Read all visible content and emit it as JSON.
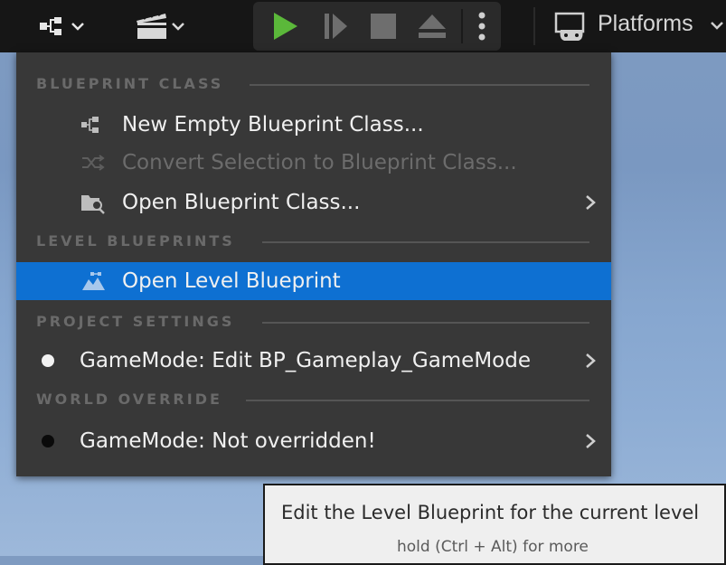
{
  "toolbar": {
    "blueprint_button_icon": "blueprint-graph-icon",
    "cinematics_button_icon": "clapperboard-icon",
    "play_controls": [
      "play-icon",
      "advance-frame-icon",
      "stop-icon",
      "eject-icon",
      "more-vertical-icon"
    ],
    "platforms_label": "Platforms",
    "play_color": "#5bb83a"
  },
  "menu": {
    "sections": [
      {
        "title": "BLUEPRINT CLASS"
      },
      {
        "title": "LEVEL BLUEPRINTS"
      },
      {
        "title": "PROJECT SETTINGS"
      },
      {
        "title": "WORLD OVERRIDE"
      }
    ],
    "items": [
      {
        "label": "New Empty Blueprint Class...",
        "icon": "blueprint-class-icon",
        "enabled": true
      },
      {
        "label": "Convert Selection to Blueprint Class...",
        "icon": "convert-shuffle-icon",
        "enabled": false
      },
      {
        "label": "Open Blueprint Class...",
        "icon": "folder-search-icon",
        "enabled": true,
        "submenu": true
      },
      {
        "label": "Open Level Blueprint",
        "icon": "level-blueprint-icon",
        "enabled": true,
        "highlighted": true
      },
      {
        "label": "GameMode: Edit BP_Gameplay_GameMode",
        "icon": "white-dot-icon",
        "enabled": true,
        "submenu": true
      },
      {
        "label": "GameMode: Not overridden!",
        "icon": "black-dot-icon",
        "enabled": true,
        "submenu": true
      }
    ],
    "highlight_color": "#0e70d2"
  },
  "tooltip": {
    "main": "Edit the Level Blueprint for the current level",
    "sub": "hold (Ctrl + Alt) for more"
  }
}
